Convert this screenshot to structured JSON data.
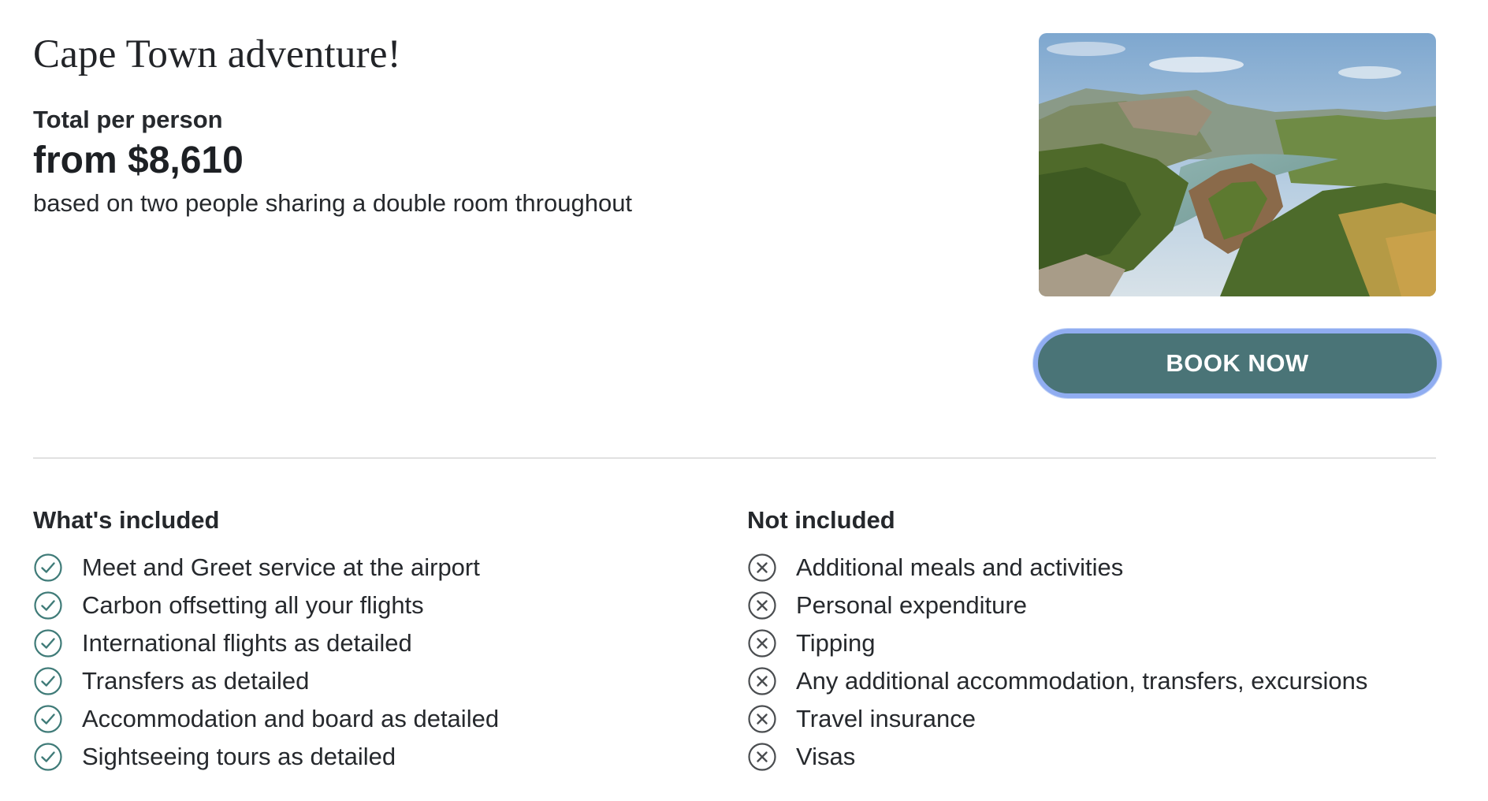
{
  "trip": {
    "title": "Cape Town adventure!",
    "price_label": "Total per person",
    "price_value": "from $8,610",
    "price_note": "based on two people sharing a double room throughout"
  },
  "actions": {
    "book_label": "BOOK NOW"
  },
  "included": {
    "heading": "What's included",
    "icon": "check-circle-icon",
    "items": [
      "Meet and Greet service at the airport",
      "Carbon offsetting all your flights",
      "International flights as detailed",
      "Transfers as detailed",
      "Accommodation and board as detailed",
      "Sightseeing tours as detailed"
    ]
  },
  "not_included": {
    "heading": "Not included",
    "icon": "x-circle-icon",
    "items": [
      "Additional meals and activities",
      "Personal expenditure",
      "Tipping",
      "Any additional accommodation, transfers, excursions",
      "Travel insurance",
      "Visas"
    ]
  },
  "colors": {
    "button_bg": "#4a7477",
    "button_focus_ring": "#90adf1",
    "check_icon": "#3f7b78",
    "x_icon": "#4a4d50",
    "divider": "#e1e1e1"
  }
}
